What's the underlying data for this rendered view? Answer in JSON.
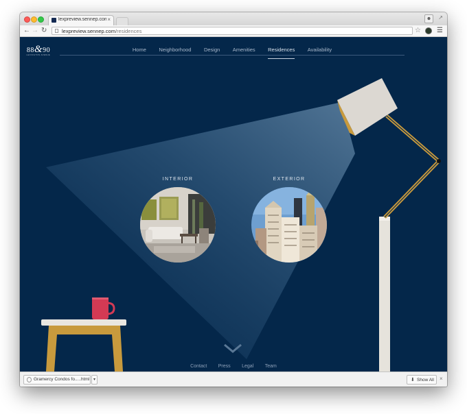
{
  "browser": {
    "tab_title": "lexpreview.sennep.com/re",
    "tab_close": "×",
    "url_host": "lexpreview.sennep.com",
    "url_path": "/residences",
    "icons": {
      "back": "back-arrow-icon",
      "forward": "forward-arrow-icon",
      "reload": "reload-icon",
      "star": "star-icon",
      "menu": "hamburger-menu-icon"
    }
  },
  "logo": {
    "left": "88",
    "amp": "&",
    "right": "90",
    "sub": "LEXINGTON AVENUE"
  },
  "nav": {
    "items": [
      {
        "label": "Home",
        "active": false
      },
      {
        "label": "Neighborhood",
        "active": false
      },
      {
        "label": "Design",
        "active": false
      },
      {
        "label": "Amenities",
        "active": false
      },
      {
        "label": "Residences",
        "active": true
      },
      {
        "label": "Availability",
        "active": false
      }
    ]
  },
  "residences": {
    "interior_label": "INTERIOR",
    "exterior_label": "EXTERIOR"
  },
  "footer": {
    "links": [
      "Contact",
      "Press",
      "Legal",
      "Team"
    ]
  },
  "downloads": {
    "file_name": "Gramercy Condos fo.....html",
    "show_all": "Show All",
    "close": "×"
  },
  "colors": {
    "page_bg": "#04274a",
    "lamp_arm": "#c89a3d",
    "lamp_shade": "#dcd8d2",
    "mug": "#d33a54",
    "table_wood": "#c89a3d",
    "table_top": "#e9e6e0"
  }
}
